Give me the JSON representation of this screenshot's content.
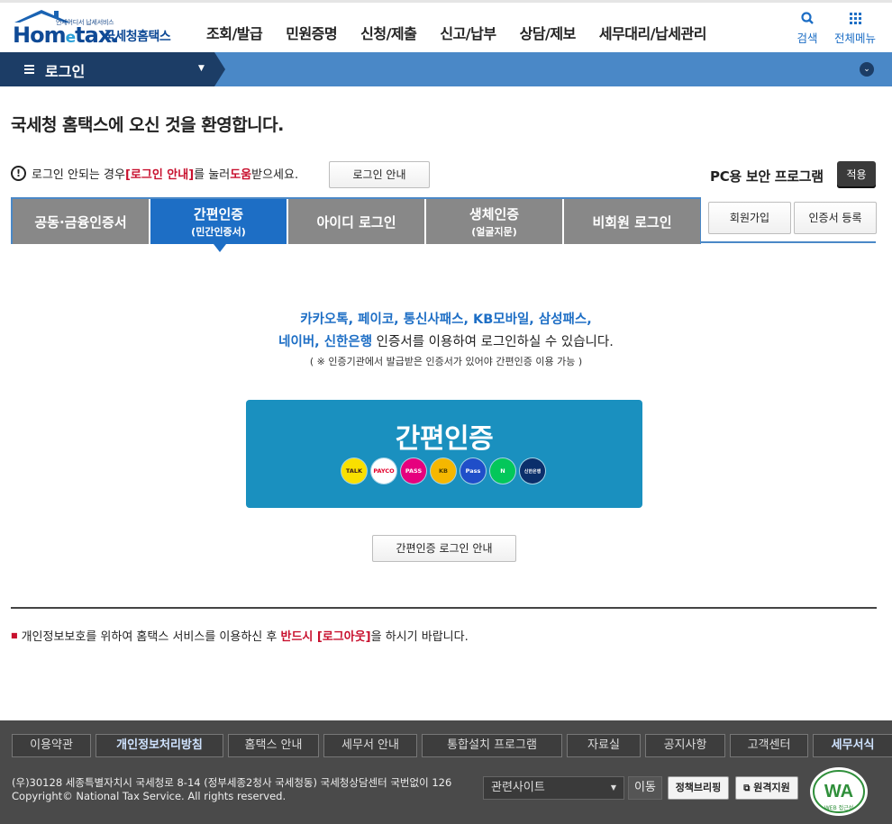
{
  "header": {
    "logo_tagline": "언제어디서 납세서비스",
    "logo_word_a": "Hom",
    "logo_word_e": "e",
    "logo_word_b": "tax.",
    "logo_kname": "국세청홈택스",
    "menu": [
      "조회/발급",
      "민원증명",
      "신청/제출",
      "신고/납부",
      "상담/제보",
      "세무대리/납세관리"
    ],
    "search_label": "검색",
    "all_menu_label": "전체메뉴"
  },
  "navbar": {
    "crumb": "로그인",
    "accent": "#4a88c7"
  },
  "content": {
    "welcome": "국세청 홈택스에 오신 것을 환영합니다.",
    "help_pre": "로그인 안되는 경우 ",
    "help_link": "[로그인 안내]",
    "help_mid": "를 눌러 ",
    "help_strong": "도움",
    "help_post": "받으세요.",
    "login_guide_btn": "로그인 안내",
    "pc_security": "PC용 보안 프로그램",
    "apply_btn": "적용"
  },
  "tabs": [
    {
      "label": "공동·금융인증서",
      "sub": ""
    },
    {
      "label": "간편인증",
      "sub": "(민간인증서)"
    },
    {
      "label": "아이디 로그인",
      "sub": ""
    },
    {
      "label": "생체인증",
      "sub": "(얼굴지문)"
    },
    {
      "label": "비회원 로그인",
      "sub": ""
    }
  ],
  "active_tab": "간편인증",
  "side_buttons": {
    "join": "회원가입",
    "cert_register": "인증서 등록"
  },
  "panel": {
    "line1": "카카오톡, 페이코, 통신사패스, KB모바일, 삼성패스,",
    "line2_blue": "네이버, 신한은행",
    "line2_rest": " 인증서를 이용하여 로그인하실 수 있습니다.",
    "note": "( ※ 인증기관에서 발급받은 인증서가 있어야 간편인증 이용 가능 )",
    "easy_title": "간편인증",
    "providers": [
      {
        "name": "TALK",
        "color": "#f9e000",
        "fg": "#3a1d1d"
      },
      {
        "name": "PAYCO",
        "color": "#ffffff",
        "fg": "#e3002c"
      },
      {
        "name": "PASS",
        "color": "#e6007e",
        "fg": "#ffffff"
      },
      {
        "name": "KB",
        "color": "#f5b700",
        "fg": "#4a3b00"
      },
      {
        "name": "Pass",
        "color": "#1f4ec9",
        "fg": "#ffffff"
      },
      {
        "name": "N",
        "color": "#03c75a",
        "fg": "#ffffff"
      },
      {
        "name": "신한은행",
        "color": "#0b2f6b",
        "fg": "#ffffff"
      }
    ],
    "guide_btn": "간편인증 로그인 안내"
  },
  "notice": {
    "pre": "개인정보보호를 위하여 홈택스 서비스를 이용하신 후 ",
    "red": "반드시 [로그아웃]",
    "post": "을 하시기 바랍니다."
  },
  "footer": {
    "links": [
      {
        "label": "이용약관",
        "hl": false
      },
      {
        "label": "개인정보처리방침",
        "hl": true
      },
      {
        "label": "홈택스 안내",
        "hl": false
      },
      {
        "label": "세무서 안내",
        "hl": false
      },
      {
        "label": "통합설치 프로그램",
        "hl": false
      },
      {
        "label": "자료실",
        "hl": false
      },
      {
        "label": "공지사항",
        "hl": false
      },
      {
        "label": "고객센터",
        "hl": false
      },
      {
        "label": "세무서식",
        "hl": true
      }
    ],
    "address": "(우)30128 세종특별자치시 국세청로 8-14 (정부세종2청사 국세청동) 국세청상담센터 국번없이 126",
    "copyright": "Copyright© National Tax Service. All rights reserved.",
    "related_sites": "관련사이트",
    "go": "이동",
    "policy_briefing": "정책브리핑",
    "remote_support": "원격지원",
    "wa_text": "WEB 접근성"
  }
}
